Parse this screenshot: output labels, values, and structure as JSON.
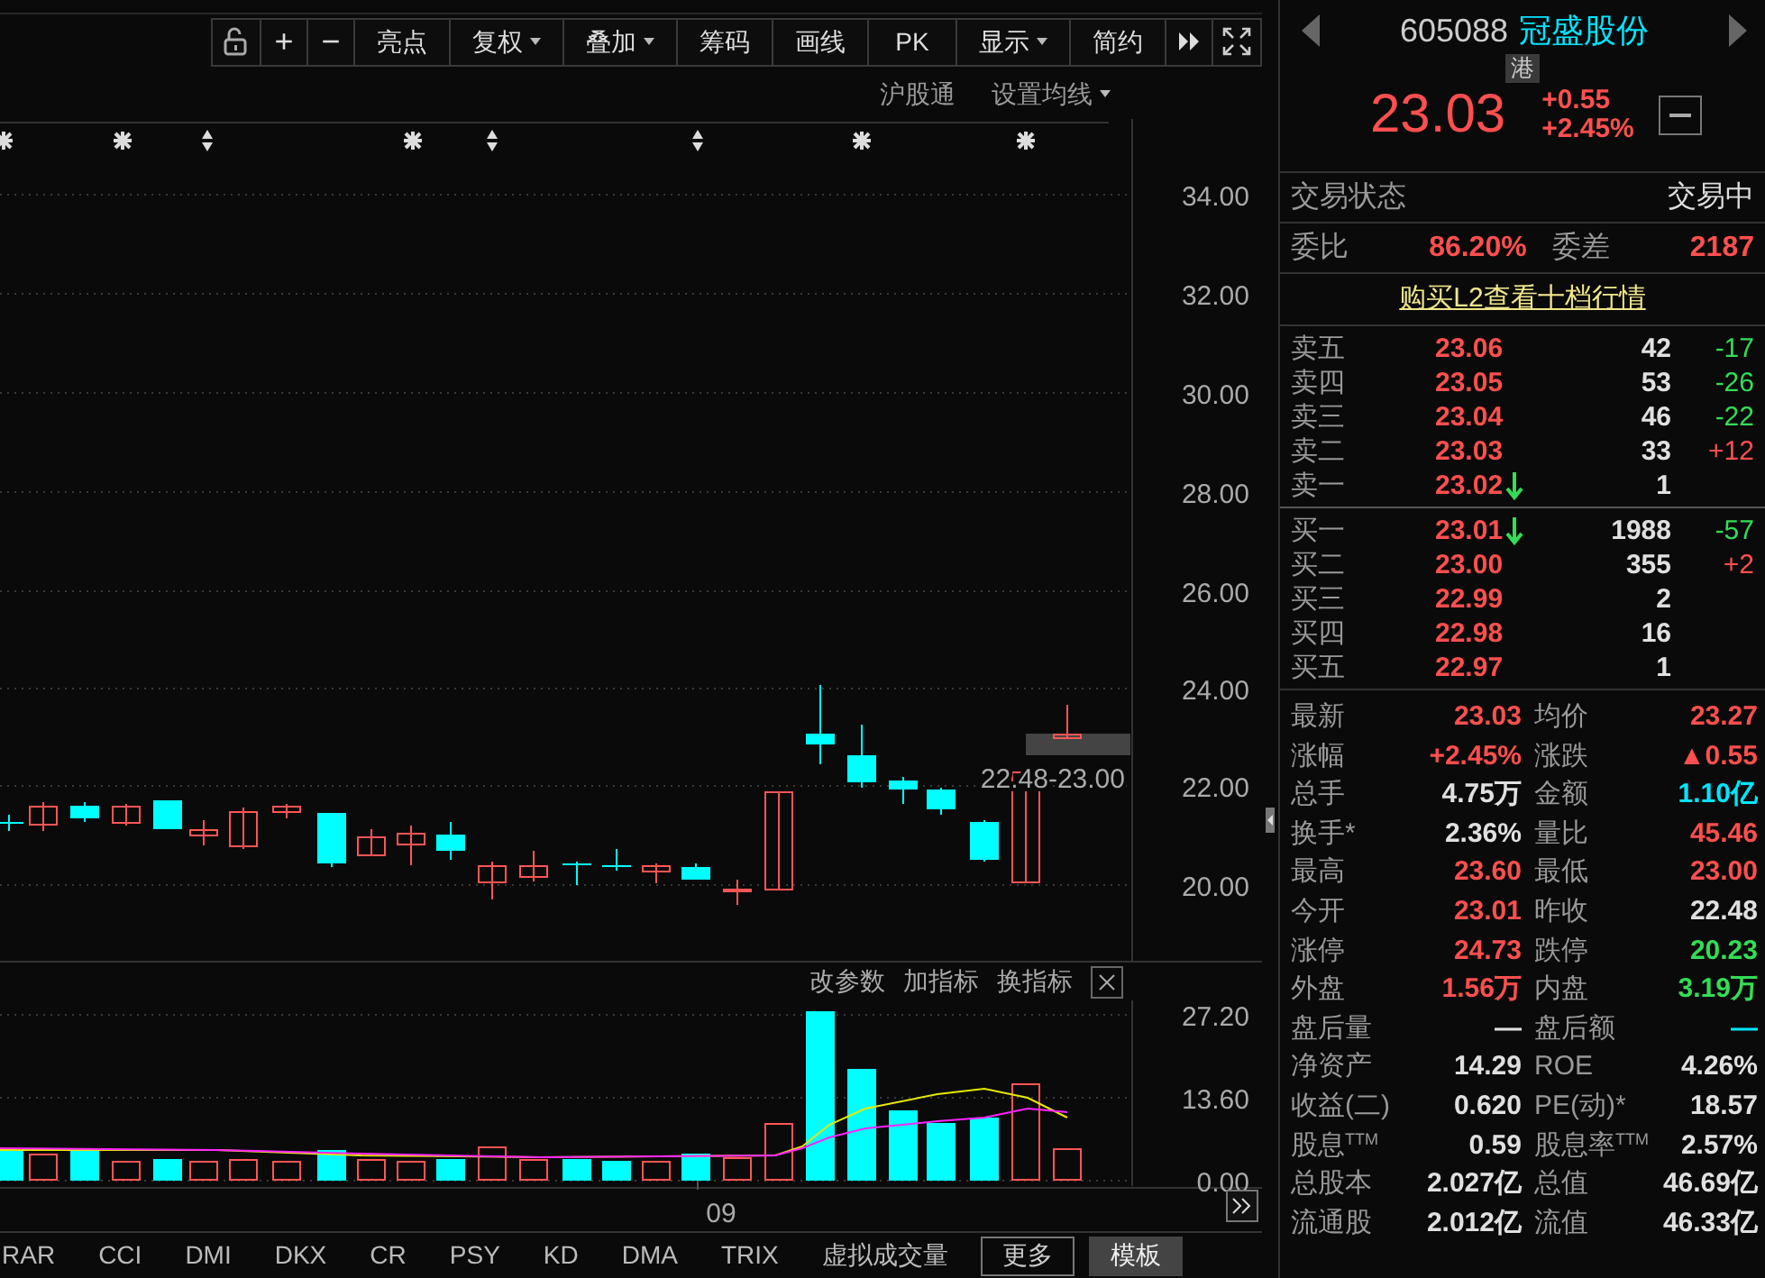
{
  "toolbar": {
    "buttons": [
      {
        "label": "+",
        "dropdown": false
      },
      {
        "label": "−",
        "dropdown": false
      },
      {
        "label": "亮点",
        "dropdown": false
      },
      {
        "label": "复权",
        "dropdown": true
      },
      {
        "label": "叠加",
        "dropdown": true
      },
      {
        "label": "筹码",
        "dropdown": false
      },
      {
        "label": "画线",
        "dropdown": false
      },
      {
        "label": "PK",
        "dropdown": false
      },
      {
        "label": "显示",
        "dropdown": true
      },
      {
        "label": "简约",
        "dropdown": false
      }
    ]
  },
  "chart_header": {
    "link": "沪股通",
    "ma_menu": "设置均线"
  },
  "price_axis": [
    "34.00",
    "32.00",
    "30.00",
    "28.00",
    "26.00",
    "24.00",
    "22.00",
    "20.00"
  ],
  "range_label": "22.48-23.00",
  "indicator_header": {
    "actions": [
      "改参数",
      "加指标",
      "换指标"
    ]
  },
  "volume_axis": [
    "27.20",
    "13.60",
    "0.00"
  ],
  "date_label": "09",
  "bottom_tabs": [
    {
      "label": "RAR",
      "kind": "tab"
    },
    {
      "label": "CCI",
      "kind": "tab"
    },
    {
      "label": "DMI",
      "kind": "tab"
    },
    {
      "label": "DKX",
      "kind": "tab"
    },
    {
      "label": "CR",
      "kind": "tab"
    },
    {
      "label": "PSY",
      "kind": "tab"
    },
    {
      "label": "KD",
      "kind": "tab"
    },
    {
      "label": "DMA",
      "kind": "tab"
    },
    {
      "label": "TRIX",
      "kind": "tab"
    },
    {
      "label": "虚拟成交量",
      "kind": "tab"
    },
    {
      "label": "更多",
      "kind": "outline"
    },
    {
      "label": "模板",
      "kind": "filled"
    }
  ],
  "quote": {
    "code": "605088",
    "name": "冠盛股份",
    "badge": "港",
    "price": "23.03",
    "change": "+0.55",
    "change_pct": "+2.45%"
  },
  "status": {
    "label": "交易状态",
    "value": "交易中"
  },
  "ratio": [
    {
      "label": "委比",
      "value": "86.20%"
    },
    {
      "label": "委差",
      "value": "2187"
    }
  ],
  "l2_link": "购买L2查看十档行情",
  "asks": [
    {
      "label": "卖五",
      "price": "23.06",
      "volume": "42",
      "change": "-17",
      "color": "#33dd55",
      "arrow": false
    },
    {
      "label": "卖四",
      "price": "23.05",
      "volume": "53",
      "change": "-26",
      "color": "#33dd55",
      "arrow": false
    },
    {
      "label": "卖三",
      "price": "23.04",
      "volume": "46",
      "change": "-22",
      "color": "#33dd55",
      "arrow": false
    },
    {
      "label": "卖二",
      "price": "23.03",
      "volume": "33",
      "change": "+12",
      "color": "#ff4f4f",
      "arrow": false
    },
    {
      "label": "卖一",
      "price": "23.02",
      "volume": "1",
      "arrow": true
    }
  ],
  "bids": [
    {
      "label": "买一",
      "price": "23.01",
      "volume": "1988",
      "change": "-57",
      "color": "#33dd55",
      "arrow": true
    },
    {
      "label": "买二",
      "price": "23.00",
      "volume": "355",
      "change": "+2",
      "color": "#ff4f4f",
      "arrow": false
    },
    {
      "label": "买三",
      "price": "22.99",
      "volume": "2",
      "arrow": false
    },
    {
      "label": "买四",
      "price": "22.98",
      "volume": "16",
      "arrow": false
    },
    {
      "label": "买五",
      "price": "22.97",
      "volume": "1",
      "arrow": false
    }
  ],
  "stats": [
    [
      {
        "label": "最新",
        "value": "23.03",
        "color": "#ff4f4f"
      },
      {
        "label": "均价",
        "value": "23.27",
        "color": "#ff4f4f"
      }
    ],
    [
      {
        "label": "涨幅",
        "value": "+2.45%",
        "color": "#ff4f4f"
      },
      {
        "label": "涨跌",
        "value": "▲0.55",
        "color": "#ff4f4f"
      }
    ],
    [
      {
        "label": "总手",
        "value": "4.75万",
        "color": "#e0e0e0"
      },
      {
        "label": "金额",
        "value": "1.10亿",
        "color": "#00e5ff"
      }
    ],
    [
      {
        "label": "换手*",
        "value": "2.36%",
        "color": "#e0e0e0"
      },
      {
        "label": "量比",
        "value": "45.46",
        "color": "#ff4f4f"
      }
    ],
    [
      {
        "label": "最高",
        "value": "23.60",
        "color": "#ff4f4f"
      },
      {
        "label": "最低",
        "value": "23.00",
        "color": "#ff4f4f"
      }
    ],
    [
      {
        "label": "今开",
        "value": "23.01",
        "color": "#ff4f4f"
      },
      {
        "label": "昨收",
        "value": "22.48",
        "color": "#e0e0e0"
      }
    ],
    [
      {
        "label": "涨停",
        "value": "24.73",
        "color": "#ff4f4f"
      },
      {
        "label": "跌停",
        "value": "20.23",
        "color": "#33dd55"
      }
    ],
    [
      {
        "label": "外盘",
        "value": "1.56万",
        "color": "#ff4f4f"
      },
      {
        "label": "内盘",
        "value": "3.19万",
        "color": "#33dd55"
      }
    ],
    [
      {
        "label": "盘后量",
        "value": "—",
        "color": "#e0e0e0"
      },
      {
        "label": "盘后额",
        "value": "—",
        "color": "#00e5ff"
      }
    ],
    [
      {
        "label": "净资产",
        "value": "14.29",
        "color": "#e0e0e0"
      },
      {
        "label": "ROE",
        "value": "4.26%",
        "color": "#e0e0e0"
      }
    ],
    [
      {
        "label": "收益(二)",
        "value": "0.620",
        "color": "#e0e0e0"
      },
      {
        "label": "PE(动)*",
        "value": "18.57",
        "color": "#e0e0e0"
      }
    ],
    [
      {
        "label": "股息$^{TTM}$",
        "value": "0.59",
        "color": "#e0e0e0"
      },
      {
        "label": "股息率$^{TTM}$",
        "value": "2.57%",
        "color": "#e0e0e0"
      }
    ],
    [
      {
        "label": "总股本",
        "value": "2.027亿",
        "color": "#e0e0e0"
      },
      {
        "label": "总值",
        "value": "46.69亿",
        "color": "#e0e0e0"
      }
    ],
    [
      {
        "label": "流通股",
        "value": "2.012亿",
        "color": "#e0e0e0"
      },
      {
        "label": "流值",
        "value": "46.33亿",
        "color": "#e0e0e0"
      }
    ]
  ]
}
